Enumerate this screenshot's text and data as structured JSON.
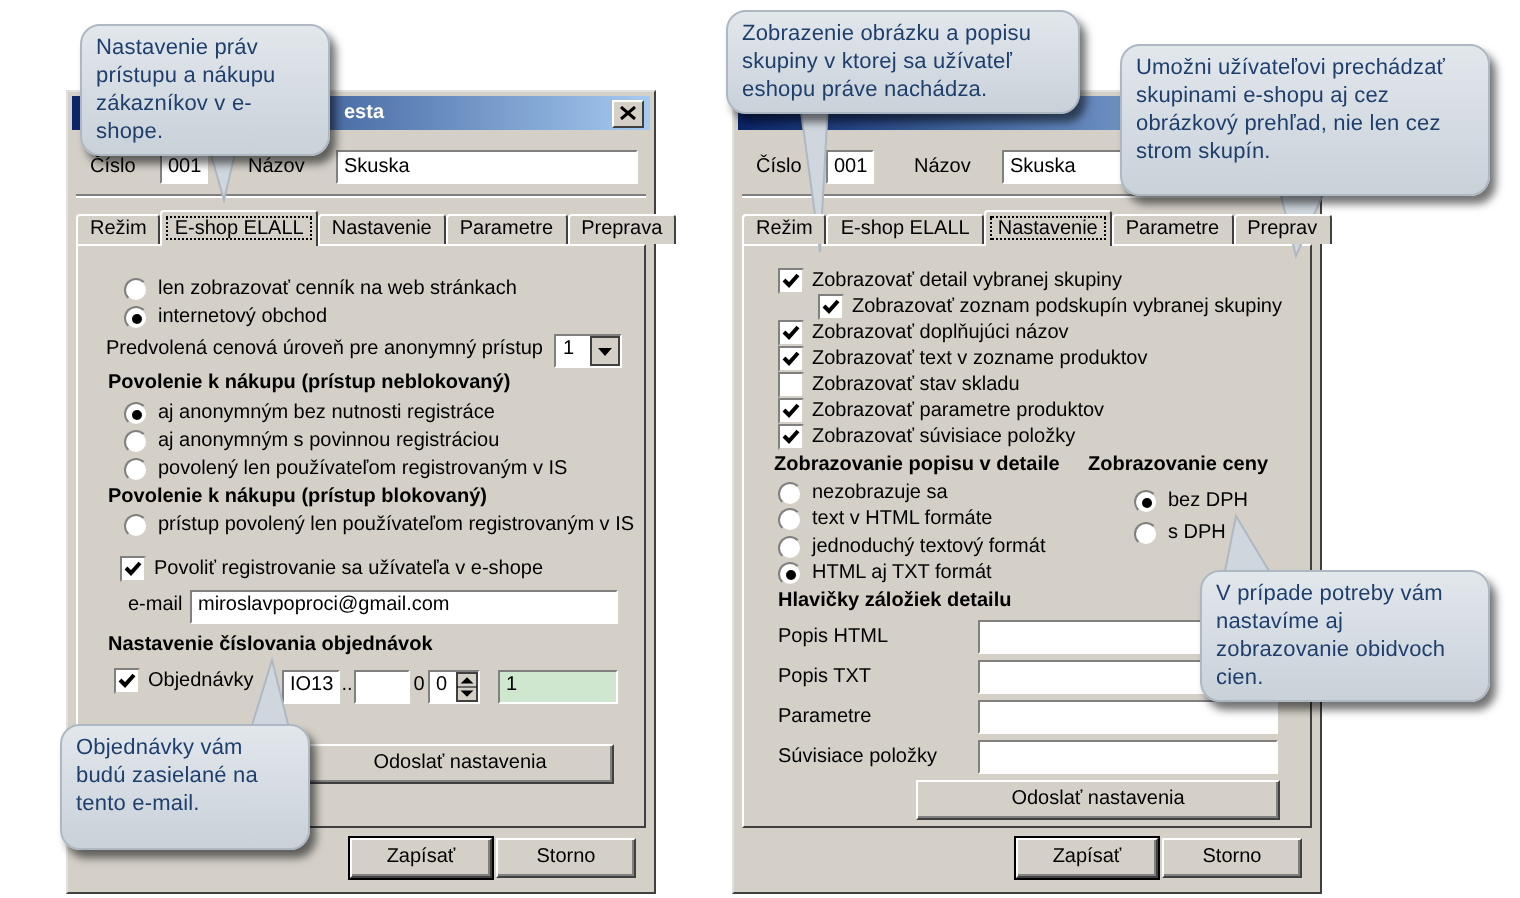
{
  "callouts": [
    {
      "text": "Nastavenie práv prístupu a nákupu zákazníkov v e-shope."
    },
    {
      "text": "Objednávky vám budú zasielané na tento e-mail."
    },
    {
      "text": "Zobrazenie obrázku a popisu skupiny v ktorej sa užívateľ eshopu práve nachádza."
    },
    {
      "text": "Umožni užívateľovi prechádzať skupinami e-shopu aj cez obrázkový prehľad, nie len cez strom skupín."
    },
    {
      "text": "V prípade potreby vám nastavíme aj zobrazovanie obidvoch cien."
    }
  ],
  "dialogs": [
    {
      "title": "esta",
      "number_label": "Číslo",
      "number": "001",
      "name_label": "Názov",
      "name": "Skuska",
      "tabs": [
        {
          "label": "Režim",
          "selected": false
        },
        {
          "label": "E-shop ELALL",
          "selected": true
        },
        {
          "label": "Nastavenie",
          "selected": false
        },
        {
          "label": "Parametre",
          "selected": false
        },
        {
          "label": "Preprava",
          "selected": false
        }
      ],
      "eshop": {
        "mode_options": [
          {
            "label": "len zobrazovať cenník na web stránkach",
            "selected": false
          },
          {
            "label": "internetový obchod",
            "selected": true
          }
        ],
        "price_level_label": "Predvolená cenová úroveň pre anonymný prístup",
        "price_level": "1",
        "unblocked_heading": "Povolenie k nákupu (prístup neblokovaný)",
        "unblocked_options": [
          {
            "label": "aj anonymným bez nutnosti registráce",
            "selected": true
          },
          {
            "label": "aj anonymným s povinnou registráciou",
            "selected": false
          },
          {
            "label": "povolený len používateľom registrovaným v IS",
            "selected": false
          }
        ],
        "blocked_heading": "Povolenie k nákupu (prístup blokovaný)",
        "blocked_options": [
          {
            "label": "prístup povolený len používateľom registrovaným v IS",
            "selected": false
          }
        ],
        "allow_registration": {
          "label": "Povoliť registrovanie sa užívateľa v e-shope",
          "checked": true
        },
        "email_label": "e-mail",
        "email": "miroslavpoproci@gmail.com",
        "numbering_heading": "Nastavenie číslovania objednávok",
        "orders": {
          "label": "Objednávky",
          "checked": true,
          "prefix": "IO13",
          "separator": "..",
          "digits_label": "0",
          "spinner": "0",
          "next_number": "1"
        },
        "send_button": "Odoslať nastavenia"
      },
      "buttons": [
        "Zapísať",
        "Storno"
      ]
    },
    {
      "number_label": "Číslo",
      "number": "001",
      "name_label": "Názov",
      "name": "Skuska",
      "tabs": [
        {
          "label": "Režim",
          "selected": false
        },
        {
          "label": "E-shop ELALL",
          "selected": false
        },
        {
          "label": "Nastavenie",
          "selected": true
        },
        {
          "label": "Parametre",
          "selected": false
        },
        {
          "label": "Preprav",
          "selected": false
        }
      ],
      "settings": {
        "checkboxes": [
          {
            "label": "Zobrazovať detail vybranej skupiny",
            "checked": true,
            "children": [
              {
                "label": "Zobrazovať zoznam podskupín vybranej skupiny",
                "checked": true
              }
            ]
          },
          {
            "label": "Zobrazovať doplňujúci názov",
            "checked": true
          },
          {
            "label": "Zobrazovať text v zozname produktov",
            "checked": true
          },
          {
            "label": "Zobrazovať stav skladu",
            "checked": false
          },
          {
            "label": "Zobrazovať parametre produktov",
            "checked": true
          },
          {
            "label": "Zobrazovať súvisiace položky",
            "checked": true
          }
        ],
        "description_heading": "Zobrazovanie popisu v detaile",
        "description_options": [
          {
            "label": "nezobrazuje sa",
            "selected": false
          },
          {
            "label": "text v HTML formáte",
            "selected": false
          },
          {
            "label": "jednoduchý textový formát",
            "selected": false
          },
          {
            "label": "HTML aj TXT formát",
            "selected": true
          }
        ],
        "price_heading": "Zobrazovanie ceny",
        "price_options": [
          {
            "label": "bez DPH",
            "selected": true
          },
          {
            "label": "s DPH",
            "selected": false
          }
        ],
        "headers_heading": "Hlavičky záložiek detailu",
        "header_fields": [
          {
            "label": "Popis HTML"
          },
          {
            "label": "Popis TXT"
          },
          {
            "label": "Parametre"
          },
          {
            "label": "Súvisiace položky"
          }
        ],
        "send_button": "Odoslať nastavenia"
      },
      "buttons": [
        "Zapísať",
        "Storno"
      ]
    }
  ]
}
